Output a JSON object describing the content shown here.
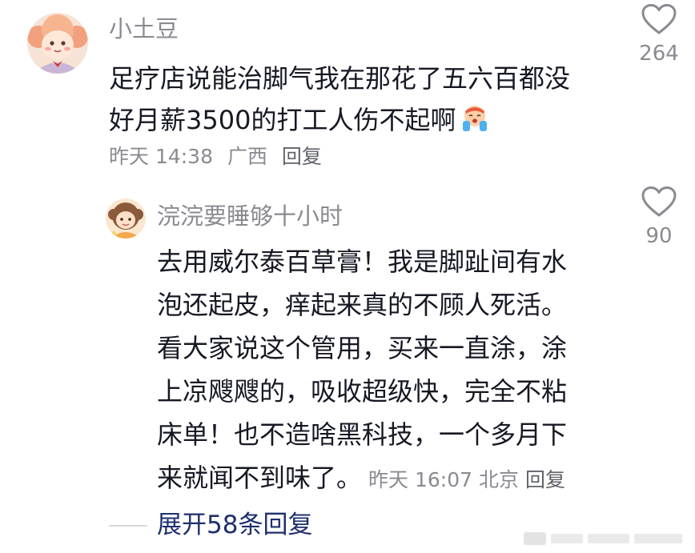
{
  "main_comment": {
    "username": "小土豆",
    "text_lines": [
      "足疗店说能治脚气我在那花了五六百都没",
      "好月薪3500的打工人伤不起啊"
    ],
    "emoji": "crying-face-emoji",
    "time": "昨天 14:38",
    "location": "广西",
    "reply_label": "回复",
    "like_count": "264"
  },
  "reply_comment": {
    "username": "浣浣要睡够十小时",
    "text_lines": [
      "去用威尔泰百草膏！我是脚趾间有水",
      "泡还起皮，痒起来真的不顾人死活。",
      "看大家说这个管用，买来一直涂，涂",
      "上凉飕飕的，吸收超级快，完全不粘",
      "床单！也不造啥黑科技，一个多月下",
      "来就闻不到味了。"
    ],
    "time": "昨天 16:07",
    "location": "北京",
    "reply_label": "回复",
    "like_count": "90"
  },
  "expand": {
    "label": "展开58条回复"
  },
  "colors": {
    "text": "#161823",
    "meta": "#8a8b91",
    "link": "#1f2f6e",
    "divider": "#d8d9dc"
  },
  "icons": {
    "like": "heart-outline-icon",
    "watermark": "watermark-logo"
  }
}
